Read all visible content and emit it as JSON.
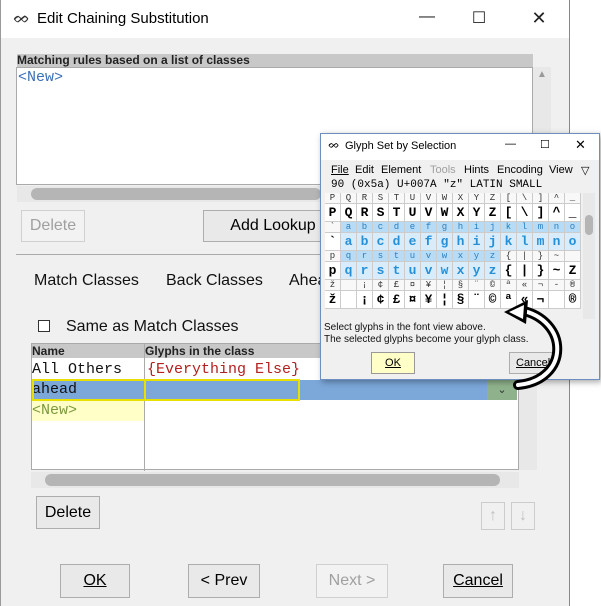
{
  "window": {
    "title": "Edit Chaining Substitution",
    "icon": "fontforge-icon"
  },
  "top_list": {
    "header": "Matching rules based on a list of classes",
    "items": [
      "<New>"
    ]
  },
  "top_buttons": {
    "delete": "Delete",
    "add_lookup": "Add Lookup"
  },
  "tabs": [
    "Match Classes",
    "Back Classes",
    "Ahead Classes"
  ],
  "same_as": {
    "label": "Same as Match Classes",
    "checked": false
  },
  "classes_table": {
    "headers": [
      "Name",
      "Glyphs in the class"
    ],
    "rows": [
      {
        "name": "All Others",
        "glyphs": "{Everything Else}"
      },
      {
        "name": "ahead",
        "glyphs": ""
      },
      {
        "name": "<New>",
        "glyphs": ""
      }
    ]
  },
  "bottom_delete": "Delete",
  "arrows": {
    "up": "↑",
    "down": "↓"
  },
  "footer": {
    "ok": "OK",
    "prev": "< Prev",
    "next": "Next >",
    "cancel": "Cancel"
  },
  "glyph_dialog": {
    "title": "Glyph Set by Selection",
    "menu": [
      "File",
      "Edit",
      "Element",
      "Tools",
      "Hints",
      "Encoding",
      "View"
    ],
    "info": "90 (0x5a) U+007A \"z\" LATIN SMALL",
    "rows": [
      {
        "labels": [
          "P",
          "Q",
          "R",
          "S",
          "T",
          "U",
          "V",
          "W",
          "X",
          "Y",
          "Z",
          "[",
          "\\",
          "]",
          "^",
          "_"
        ],
        "glyphs": [
          "P",
          "Q",
          "R",
          "S",
          "T",
          "U",
          "V",
          "W",
          "X",
          "Y",
          "Z",
          "[",
          "\\",
          "]",
          "^",
          "_"
        ]
      },
      {
        "labels": [
          "`",
          "a",
          "b",
          "c",
          "d",
          "e",
          "f",
          "g",
          "h",
          "i",
          "j",
          "k",
          "l",
          "m",
          "n",
          "o"
        ],
        "glyphs": [
          "`",
          "a",
          "b",
          "c",
          "d",
          "e",
          "f",
          "g",
          "h",
          "i",
          "j",
          "k",
          "l",
          "m",
          "n",
          "o"
        ]
      },
      {
        "labels": [
          "p",
          "q",
          "r",
          "s",
          "t",
          "u",
          "v",
          "w",
          "x",
          "y",
          "z",
          "{",
          "|",
          "}",
          "~",
          ""
        ],
        "glyphs": [
          "p",
          "q",
          "r",
          "s",
          "t",
          "u",
          "v",
          "w",
          "x",
          "y",
          "z",
          "{",
          "|",
          "}",
          "~",
          "Z"
        ]
      },
      {
        "labels": [
          "ž",
          "",
          "¡",
          "¢",
          "£",
          "¤",
          "¥",
          "¦",
          "§",
          "¨",
          "©",
          "ª",
          "«",
          "¬",
          "-",
          "®"
        ],
        "glyphs": [
          "ž",
          "",
          "¡",
          "¢",
          "£",
          "¤",
          "¥",
          "¦",
          "§",
          "¨",
          "©",
          "ª",
          "«",
          "¬",
          "",
          "®"
        ]
      }
    ],
    "hint": "Select glyphs in the font view above.\nThe selected glyphs become your glyph class.",
    "ok": "OK",
    "cancel": "Cancel"
  },
  "colors": {
    "accent": "#2a7fc0",
    "selection": "#7ba7d9",
    "highlight": "#ffff00",
    "new_text": "#3b6fb6"
  }
}
